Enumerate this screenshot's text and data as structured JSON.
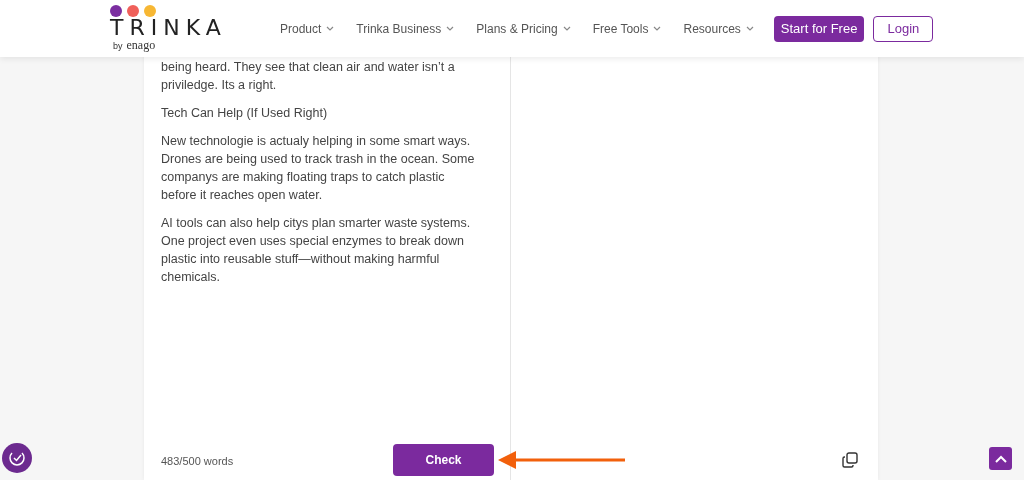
{
  "header": {
    "logo": {
      "wordmark": "TRINKA",
      "byline_prefix": "by",
      "byline_brand": "enago"
    },
    "nav": [
      {
        "label": "Product"
      },
      {
        "label": "Trinka Business"
      },
      {
        "label": "Plans & Pricing"
      },
      {
        "label": "Free Tools"
      },
      {
        "label": "Resources"
      }
    ],
    "start_button": "Start for Free",
    "login_button": "Login"
  },
  "editor": {
    "paragraphs": [
      {
        "text": "being heard. They see that clean air and water isn’t a priviledge. Its a right."
      },
      {
        "text": "Tech Can Help (If Used Right)"
      },
      {
        "text": "New technologie is actualy helping in some smart ways. Drones are being used to track trash in the ocean. Some companys are making floating traps to catch plastic before it reaches open water."
      },
      {
        "text": "AI tools can also help citys plan smarter waste systems. One project even uses special enzymes to break down plastic into reusable stuff—without making harmful chemicals."
      }
    ],
    "word_count": "483/500 words",
    "check_button": "Check"
  }
}
